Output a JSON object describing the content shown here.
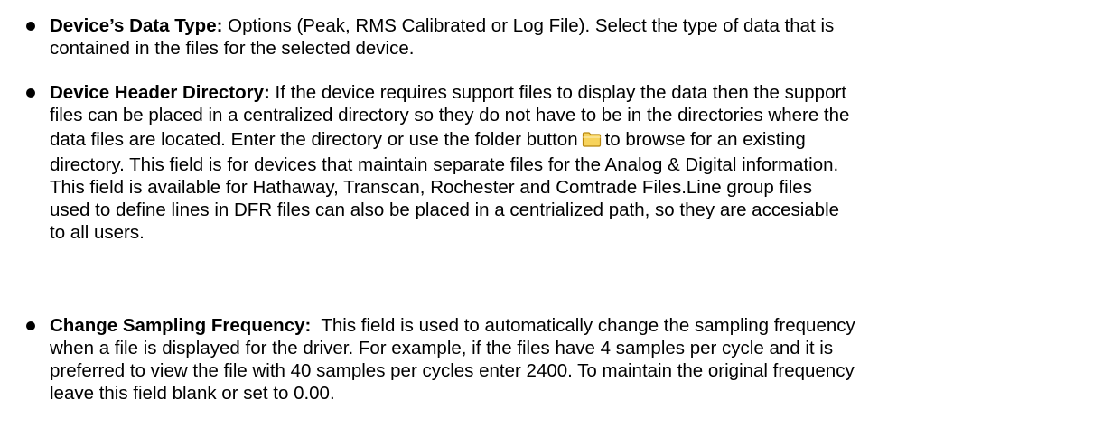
{
  "items": [
    {
      "term": "Device’s Data Type:",
      "lines": [
        " Options (Peak, RMS Calibrated or Log File). Select the type of data that is",
        "contained in the files for the selected device."
      ]
    },
    {
      "term": "Device Header Directory:",
      "lines": [
        " If the device requires support files to display the data then the support",
        "files can be placed in a centralized directory so they do not have to be in the directories where the"
      ],
      "icon_line": {
        "before": "data files are located. Enter the directory or use the folder button",
        "icon": "folder-icon",
        "after": "to browse for an existing"
      },
      "lines_after": [
        "directory. This field is for devices that maintain separate files for the Analog & Digital information.",
        "This field is available for Hathaway, Transcan, Rochester and Comtrade Files.Line group files",
        "used to define lines in DFR files can also be placed in a centrialized path, so they are accesiable",
        "to all users."
      ]
    },
    {
      "term": "Change Sampling Frequency:",
      "lines": [
        "  This field is used to automatically change the sampling frequency",
        "when a file is displayed for the driver. For example, if the files have 4 samples per cycle and it is",
        "preferred to view the file with 40 samples per cycles enter 2400. To maintain the original frequency",
        "leave this field blank or set to 0.00."
      ]
    }
  ],
  "colors": {
    "text": "#000000",
    "folder_fill": "#f7d35c",
    "folder_stroke": "#b8860b"
  }
}
